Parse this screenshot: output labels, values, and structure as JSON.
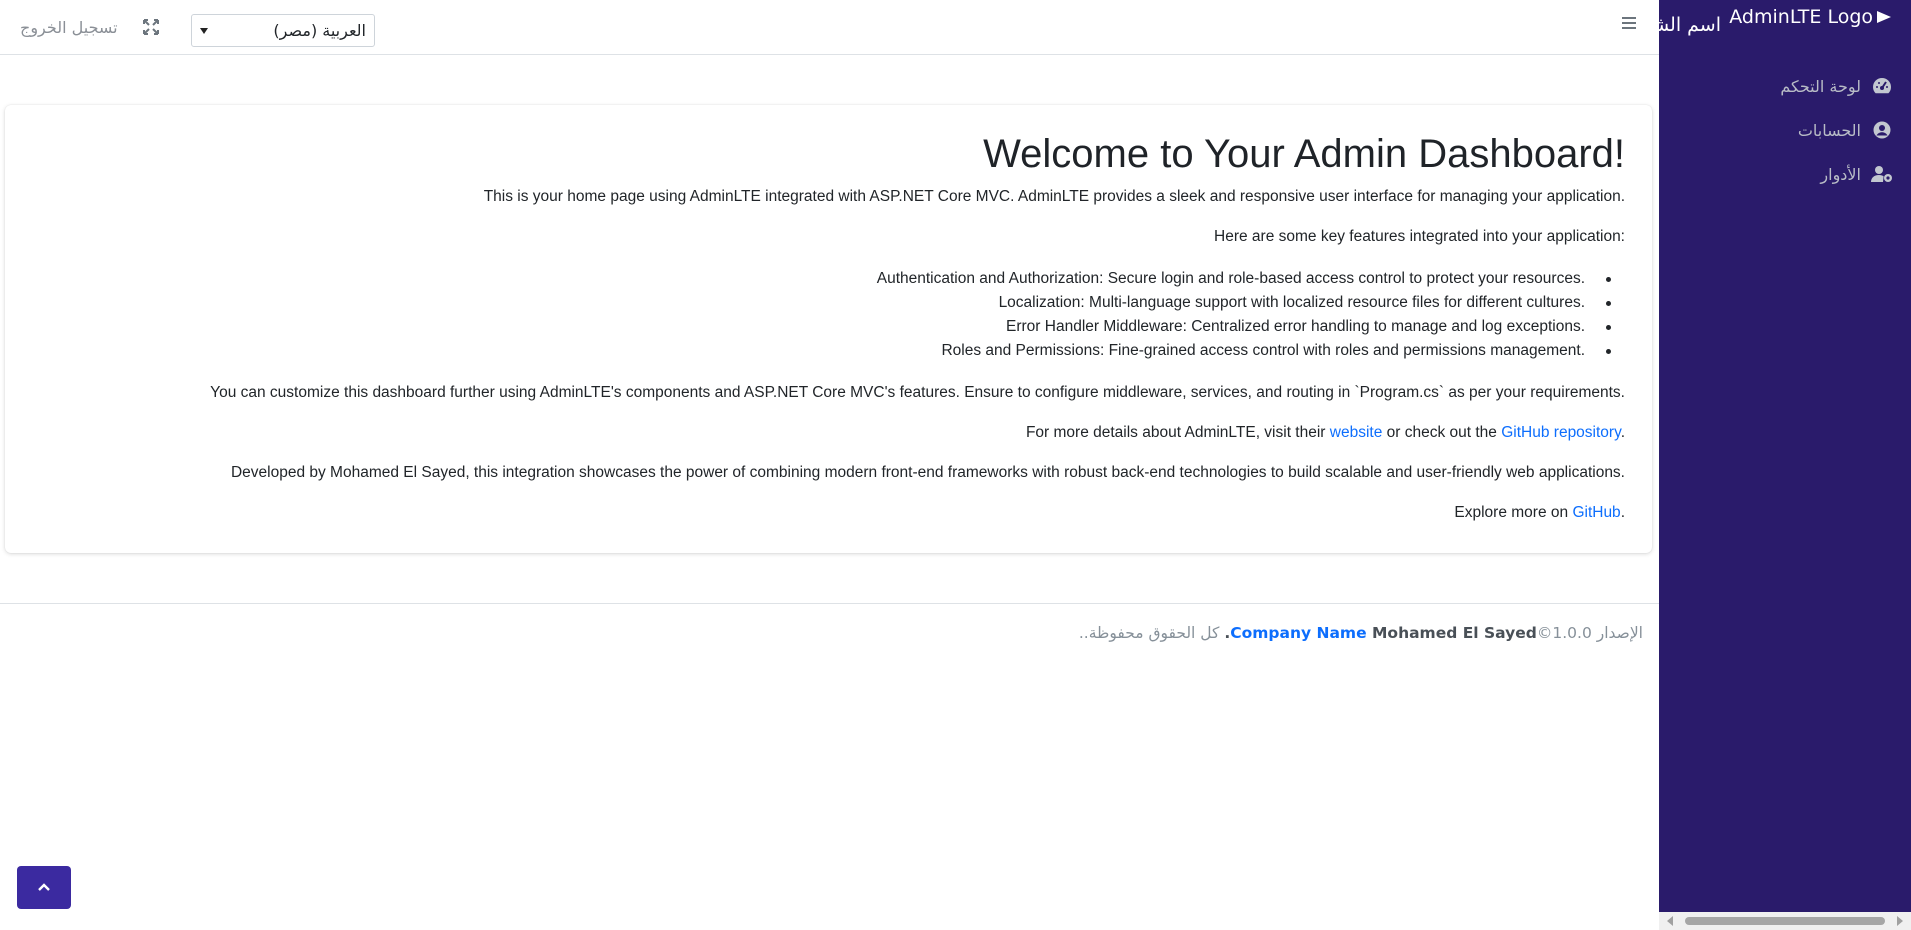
{
  "sidebar": {
    "brand_logo": "AdminLTE Logo",
    "brand_name": "اسم الشركة",
    "items": [
      {
        "label": "لوحة التحكم",
        "icon": "dashboard-gauge-icon"
      },
      {
        "label": "الحسابات",
        "icon": "user-circle-icon"
      },
      {
        "label": "الأدوار",
        "icon": "users-cog-icon"
      }
    ]
  },
  "topbar": {
    "language_selected": "العربية (مصر)",
    "logout_label": "تسجيل الخروج"
  },
  "content": {
    "title": "Welcome to Your Admin Dashboard!",
    "intro": "This is your home page using AdminLTE integrated with ASP.NET Core MVC. AdminLTE provides a sleek and responsive user interface for managing your application.",
    "features_intro": "Here are some key features integrated into your application:",
    "features": [
      "Authentication and Authorization: Secure login and role-based access control to protect your resources.",
      "Localization: Multi-language support with localized resource files for different cultures.",
      "Error Handler Middleware: Centralized error handling to manage and log exceptions.",
      "Roles and Permissions: Fine-grained access control with roles and permissions management."
    ],
    "customize": "You can customize this dashboard further using AdminLTE's components and ASP.NET Core MVC's features. Ensure to configure middleware, services, and routing in `Program.cs` as per your requirements.",
    "details_prefix": "For more details about AdminLTE, visit their ",
    "website_link": "website",
    "details_middle": " or check out the ",
    "repo_link": "GitHub repository",
    "details_suffix": ".",
    "developed": "Developed by Mohamed El Sayed, this integration showcases the power of combining modern front-end frameworks with robust back-end technologies to build scalable and user-friendly web applications.",
    "explore_prefix": "Explore more on ",
    "explore_link": "GitHub",
    "explore_suffix": "."
  },
  "footer": {
    "version": "الإصدار 1.0.0",
    "copyright": "©",
    "company_link": "Company Name",
    "owner": " Mohamed El Sayed.",
    "rights": " كل الحقوق محفوظة.."
  },
  "colors": {
    "sidebar_bg": "#2a1b6b",
    "link": "#0d6efd",
    "to_top_button": "#3b2aa0"
  }
}
